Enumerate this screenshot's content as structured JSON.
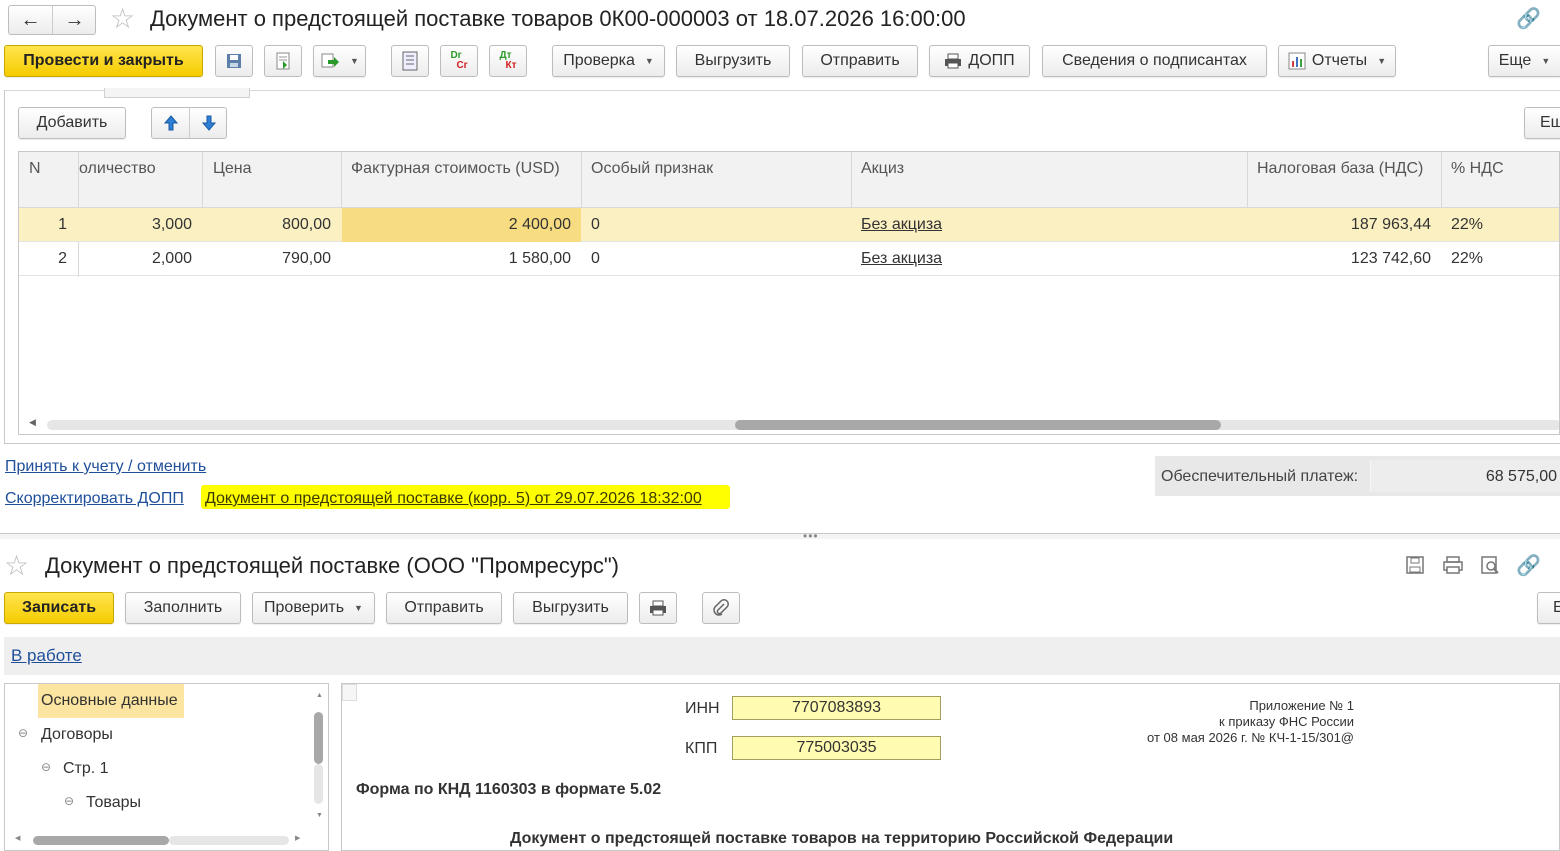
{
  "top_window": {
    "title": "Документ о предстоящей поставке товаров 0К00-000003 от 18.07.2026 16:00:00",
    "toolbar": {
      "post_close": "Провести и закрыть",
      "check": "Проверка",
      "export": "Выгрузить",
      "send": "Отправить",
      "dopp": "ДОПП",
      "signers": "Сведения о подписантах",
      "reports": "Отчеты",
      "more": "Еще"
    },
    "table_toolbar": {
      "add": "Добавить",
      "more": "Еш"
    },
    "table": {
      "columns": [
        "N",
        "оличество",
        "Цена",
        "Фактурная стоимость (USD)",
        "Особый признак",
        "Акциз",
        "Налоговая база (НДС)",
        "% НДС"
      ],
      "rows": [
        {
          "n": "1",
          "qty": "3,000",
          "price": "800,00",
          "cost": "2 400,00",
          "flag": "0",
          "excise": "Без акциза",
          "base": "187 963,44",
          "vat": "22%"
        },
        {
          "n": "2",
          "qty": "2,000",
          "price": "790,00",
          "cost": "1 580,00",
          "flag": "0",
          "excise": "Без акциза",
          "base": "123 742,60",
          "vat": "22%"
        }
      ]
    },
    "links": {
      "accept": "Принять к учету / отменить",
      "correct": "Скорректировать ДОПП",
      "doc_link": "Документ о предстоящей поставке (корр. 5) от 29.07.2026 18:32:00"
    },
    "security_payment": {
      "label": "Обеспечительный платеж:",
      "value": "68 575,00"
    }
  },
  "bottom_window": {
    "title": "Документ о предстоящей поставке (ООО \"Промресурс\")",
    "toolbar": {
      "save": "Записать",
      "fill": "Заполнить",
      "verify": "Проверить",
      "send": "Отправить",
      "export": "Выгрузить",
      "more": "Е"
    },
    "status": "В работе",
    "tree": [
      "Основные данные",
      "Договоры",
      "Стр. 1",
      "Товары"
    ],
    "form": {
      "inn_label": "ИНН",
      "inn_value": "7707083893",
      "kpp_label": "КПП",
      "kpp_value": "775003035",
      "annex_line1": "Приложение № 1",
      "annex_line2": "к приказу ФНС России",
      "annex_line3": "от 08 мая 2026 г. № КЧ-1-15/301@",
      "form_title": "Форма по КНД 1160303 в формате 5.02",
      "doc_heading": "Документ о предстоящей поставке товаров на территорию Российской Федерации"
    }
  },
  "colors": {
    "accent_yellow": "#f5cc00",
    "selected_row": "#fbf0c2",
    "highlight": "#ffff00",
    "link": "#1f4f9a"
  }
}
